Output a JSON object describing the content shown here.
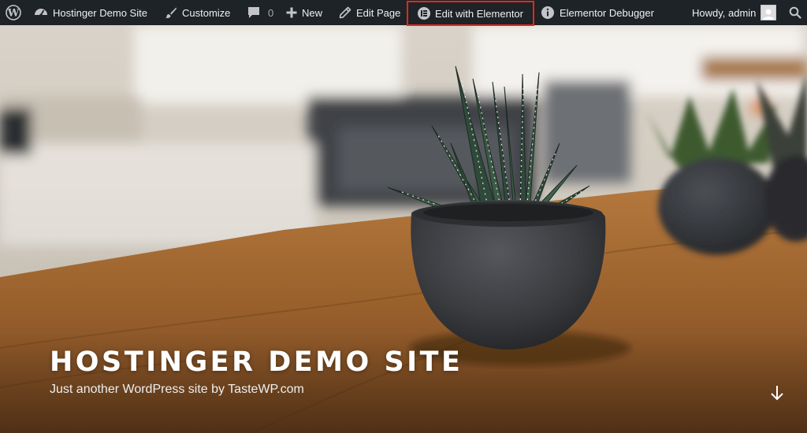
{
  "admin_bar": {
    "site_name": "Hostinger Demo Site",
    "customize": "Customize",
    "comments_count": "0",
    "new": "New",
    "edit_page": "Edit Page",
    "edit_with_elementor": "Edit with Elementor",
    "elementor_debugger": "Elementor Debugger",
    "howdy": "Howdy, admin",
    "icons": [
      "wordpress-logo-icon",
      "dashboard-icon",
      "paintbrush-icon",
      "comment-icon",
      "plus-icon",
      "pencil-icon",
      "elementor-icon",
      "info-icon",
      "avatar",
      "search-icon"
    ],
    "highlight_color": "#e8261b",
    "background_color": "#1d2327"
  },
  "hero": {
    "title": "HOSTINGER DEMO SITE",
    "tagline": "Just another WordPress site by TasteWP.com",
    "scroll_icon": "arrow-down-icon"
  }
}
